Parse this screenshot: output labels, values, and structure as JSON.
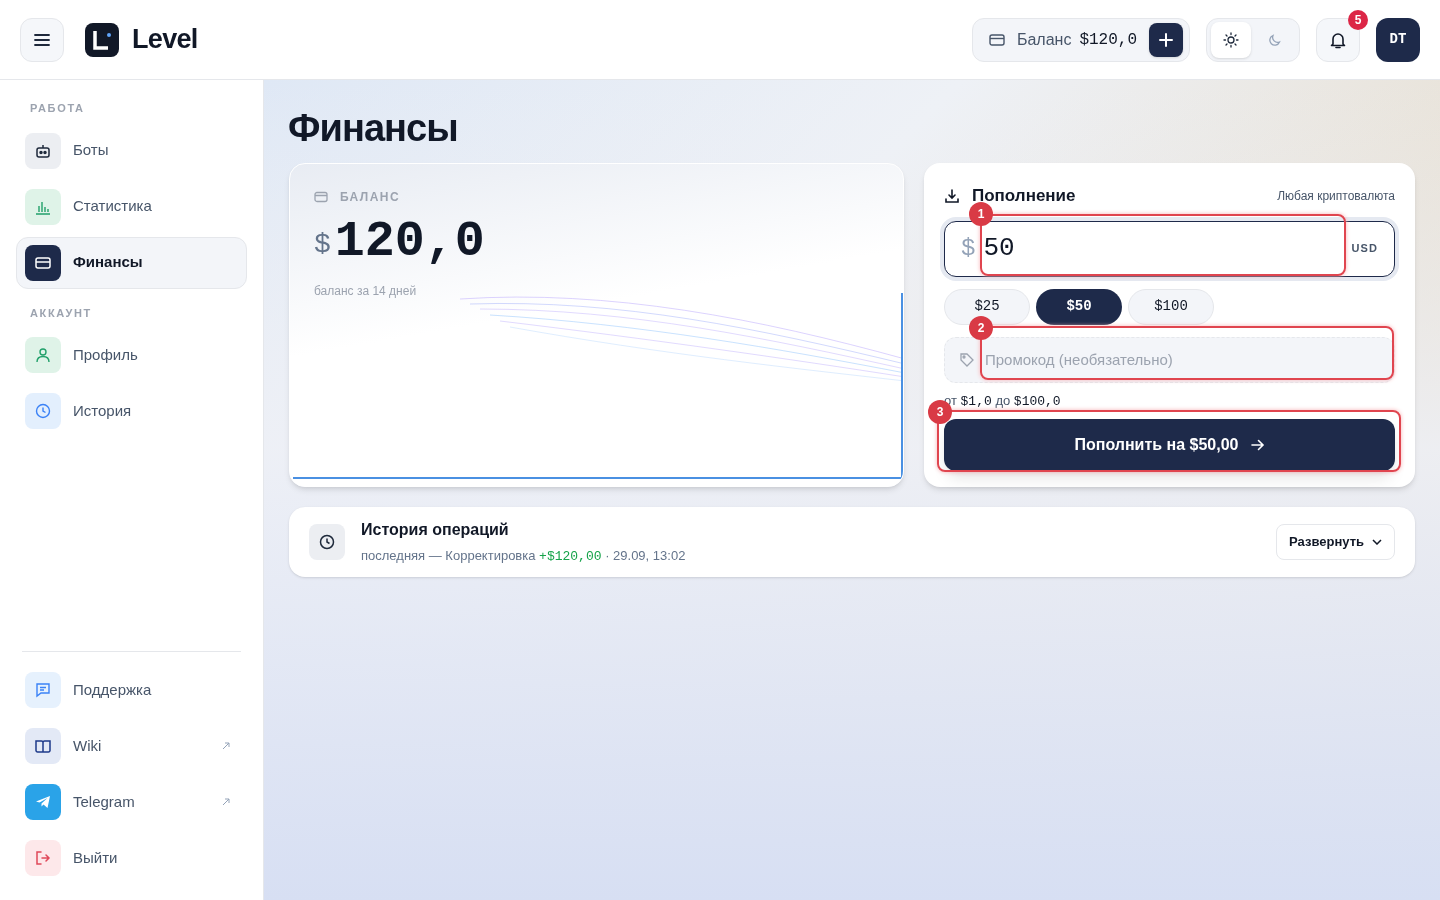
{
  "header": {
    "logo": "Level",
    "balance_label": "Баланс",
    "balance_value": "$120,0",
    "theme": [
      {
        "kind": "light",
        "selected": true
      },
      {
        "kind": "dark",
        "selected": false
      }
    ],
    "notifications": "5",
    "avatar": "DT"
  },
  "sidebar": {
    "sections": [
      {
        "title": "РАБОТА",
        "items": [
          {
            "label": "Боты",
            "selected": false
          },
          {
            "label": "Статистика",
            "selected": false
          },
          {
            "label": "Финансы",
            "selected": true
          }
        ]
      },
      {
        "title": "АККАУНТ",
        "items": [
          {
            "label": "Профиль",
            "selected": false
          },
          {
            "label": "История",
            "selected": false
          }
        ]
      }
    ],
    "footer_items": [
      {
        "label": "Поддержка",
        "external": false
      },
      {
        "label": "Wiki",
        "external": true
      },
      {
        "label": "Telegram",
        "external": true
      },
      {
        "label": "Выйти",
        "external": false
      }
    ]
  },
  "page_title": "Финансы",
  "balance_card": {
    "label": "БАЛАНС",
    "currency": "$",
    "amount": "120,0",
    "caption": "баланс за 14 дней"
  },
  "topup": {
    "title": "Пополнение",
    "subtitle": "Любая криптовалюта",
    "amount": {
      "prefix": "$",
      "value": "50",
      "suffix": "USD"
    },
    "presets": [
      {
        "label": "$25",
        "selected": false
      },
      {
        "label": "$50",
        "selected": true
      },
      {
        "label": "$100",
        "selected": false
      }
    ],
    "promo": {
      "placeholder": "Промокод (необязательно)"
    },
    "limits": {
      "from_word": "от",
      "min": "$1,0",
      "to_word": "до",
      "max": "$100,0"
    },
    "submit": "Пополнить на $50,00"
  },
  "history": {
    "title": "История операций",
    "last_label": "последняя — Корректировка",
    "amount": "+$120,00",
    "meta": "· 29.09, 13:02",
    "expand": "Развернуть"
  },
  "annotations": [
    {
      "label": "1"
    },
    {
      "label": "2"
    },
    {
      "label": "3"
    }
  ]
}
